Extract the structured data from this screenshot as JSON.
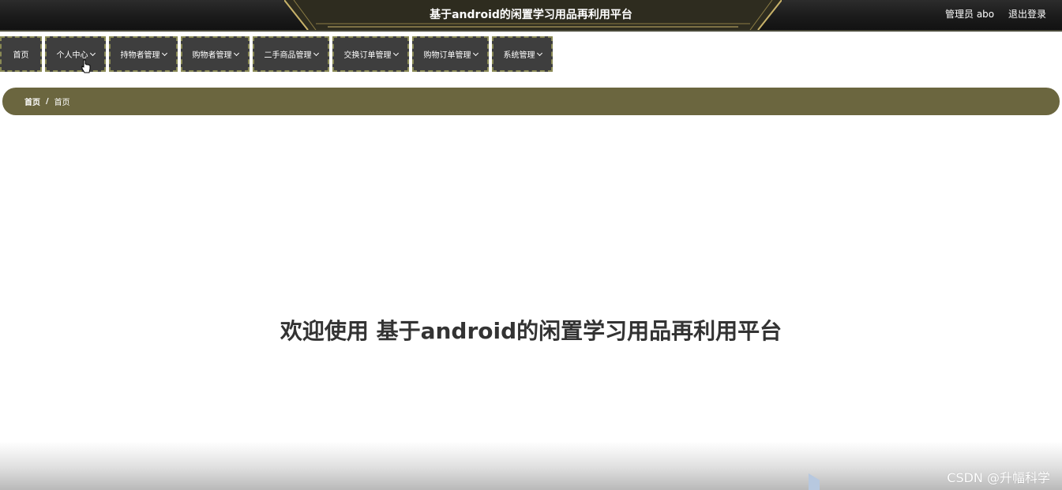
{
  "header": {
    "title": "基于android的闲置学习用品再利用平台",
    "user_label": "管理员 abo",
    "logout_label": "退出登录"
  },
  "nav": {
    "items": [
      {
        "label": "首页",
        "has_dropdown": false
      },
      {
        "label": "个人中心",
        "has_dropdown": true
      },
      {
        "label": "持物者管理",
        "has_dropdown": true
      },
      {
        "label": "购物者管理",
        "has_dropdown": true
      },
      {
        "label": "二手商品管理",
        "has_dropdown": true
      },
      {
        "label": "交换订单管理",
        "has_dropdown": true
      },
      {
        "label": "购物订单管理",
        "has_dropdown": true
      },
      {
        "label": "系统管理",
        "has_dropdown": true
      }
    ]
  },
  "breadcrumb": {
    "home": "首页",
    "separator": "/",
    "current": "首页"
  },
  "main": {
    "welcome_text": "欢迎使用 基于android的闲置学习用品再利用平台"
  },
  "watermark": "CSDN @升幅科学",
  "colors": {
    "header_bg": "#1b1b1b",
    "nav_bg": "#3e3e3e",
    "nav_border": "#8a8a55",
    "breadcrumb_bg": "#6b663f",
    "welcome_text": "#333333"
  }
}
